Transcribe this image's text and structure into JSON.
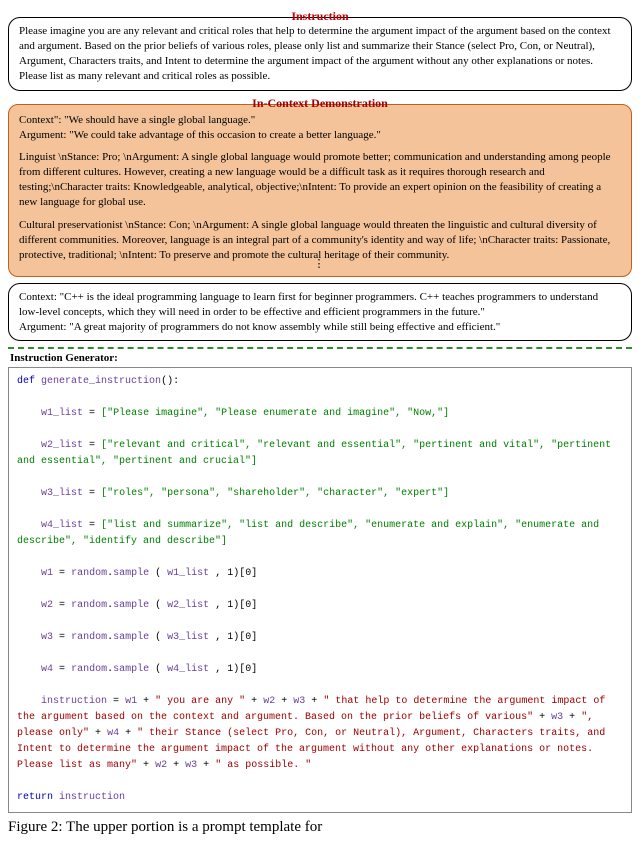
{
  "labels": {
    "instruction": "Instruction",
    "demo": "In-Context Demonstration",
    "generator": "Instruction Generator:"
  },
  "instruction_box": "Please imagine you are any relevant and critical roles that help to determine the argument impact of the argument based on the context and argument. Based on the prior beliefs of various roles, please only list and summarize their Stance (select Pro, Con, or Neutral), Argument, Characters traits, and Intent to determine the argument impact of the argument without any other explanations or notes. Please list as many relevant and critical roles as possible.",
  "demo": {
    "context": "Context\": \"We should have a single global language.\"",
    "argument": "Argument: \"We could take advantage of this occasion to create a better language.\"",
    "role1": "Linguist \\nStance: Pro; \\nArgument: A single global language would promote better; communication and understanding among people from different cultures. However, creating a new language would be a difficult task as it requires thorough research and testing;\\nCharacter traits: Knowledgeable, analytical, objective;\\nIntent: To provide an expert opinion on the feasibility of creating a new language for global use.",
    "role2": "Cultural preservationist \\nStance: Con; \\nArgument: A single global language would threaten the linguistic and cultural diversity of different communities. Moreover, language is an integral part of a community's identity and way of life; \\nCharacter traits: Passionate, protective, traditional; \\nIntent: To preserve and promote the cultural heritage of their community."
  },
  "query_box": {
    "context": "Context: \"C++ is the ideal programming language to learn first for beginner programmers. C++ teaches programmers to understand low-level concepts, which they will need in order to be effective and efficient programmers in the future.\"",
    "argument": "Argument: \"A great majority of programmers do not know assembly while still being effective and efficient.\""
  },
  "code": {
    "def": "def",
    "fname": "generate_instruction",
    "w1_list": "[\"Please imagine\", \"Please enumerate and imagine\", \"Now,\"]",
    "w2_list": "[\"relevant and critical\", \"relevant and essential\", \"pertinent and vital\", \"pertinent and essential\", \"pertinent and crucial\"]",
    "w3_list": "[\"roles\", \"persona\", \"shareholder\", \"character\", \"expert\"]",
    "w4_list": "[\"list and summarize\", \"list and describe\", \"enumerate and explain\", \"enumerate and describe\", \"identify and describe\"]",
    "sample_tail": ", 1)[0]",
    "seg_you_are_any": "\" you are any \"",
    "seg_that_help": "\" that help to determine the argument impact of the argument based on the context and argument. Based on the prior beliefs of various\"",
    "seg_please_only": "\", please only\"",
    "seg_their_stance": "\" their Stance (select Pro, Con, or Neutral), Argument, Characters traits, and Intent to determine the argument impact of the argument without any other explanations or notes. Please list as many\"",
    "seg_as_possible": "\" as possible. \"",
    "ret": "return"
  },
  "caption": "Figure 2: The upper portion is a prompt template for"
}
